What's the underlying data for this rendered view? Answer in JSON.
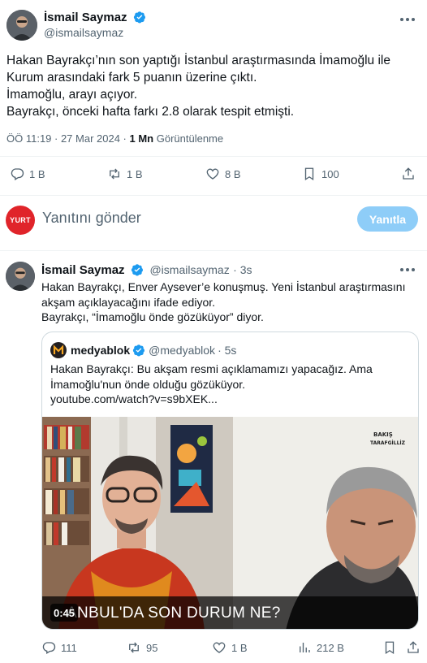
{
  "main_tweet": {
    "author_name": "İsmail Saymaz",
    "author_handle": "@ismailsaymaz",
    "lines": [
      "Hakan Bayrakçı’nın son yaptığı İstanbul araştırmasında İmamoğlu ile",
      "Kurum arasındaki fark 5 puanın üzerine çıktı.",
      "İmamoğlu, arayı açıyor.",
      "Bayrakçı, önceki hafta farkı 2.8 olarak tespit etmişti."
    ],
    "timestamp": "ÖÖ 11:19 · 27 Mar 2024 · ",
    "views_count": "1 Mn",
    "views_label": " Görüntülenme",
    "stats": {
      "replies": "1 B",
      "reposts": "1 B",
      "likes": "8 B",
      "bookmarks": "100"
    }
  },
  "reply_composer": {
    "avatar_text": "YURT",
    "placeholder": "Yanıtını gönder",
    "button_label": "Yanıtla"
  },
  "reply_tweet": {
    "author_name": "İsmail Saymaz",
    "author_handle": "@ismailsaymaz",
    "time": "· 3s",
    "lines": [
      "Hakan Bayrakçı, Enver Aysever’e konuşmuş. Yeni İstanbul araştırmasını",
      "akşam açıklayacağını ifade ediyor.",
      "Bayrakçı, “İmamoğlu önde gözüküyor” diyor."
    ],
    "quote": {
      "author_name": "medyablok",
      "author_handle": "@medyablok",
      "time": "· 5s",
      "lines": [
        "Hakan Bayrakçı: Bu akşam resmi açıklamamızı yapacağız. Ama",
        "İmamoğlu'nun önde olduğu gözüküyor.",
        "youtube.com/watch?v=s9bXEK..."
      ],
      "video_caption": "ANBUL'DA SON DURUM NE?",
      "video_duration": "0:45",
      "overlay_text_1": "BAKIŞ",
      "overlay_text_2": "TARAFGİLLİZ"
    },
    "stats": {
      "replies": "111",
      "reposts": "95",
      "likes": "1 B",
      "views": "212 B"
    }
  },
  "colors": {
    "accent": "#1d9bf0",
    "muted": "#536471",
    "verified": "#1d9bf0",
    "composer_button": "#8ecdf8",
    "yurt_red": "#e0242a"
  }
}
